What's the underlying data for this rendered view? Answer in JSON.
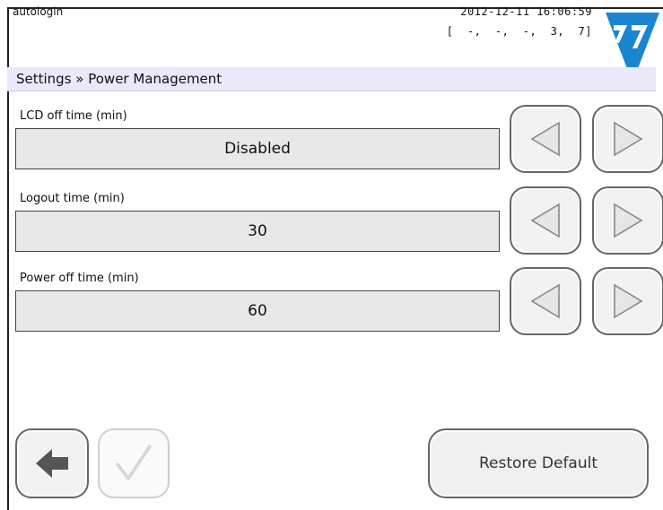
{
  "header": {
    "user": "autologin",
    "datetime": "2012-12-11 16:06:59",
    "codes": "[  -,  -,  -,  3,  7]",
    "logo_icon": "company-logo-icon"
  },
  "breadcrumb": "Settings » Power Management",
  "settings": [
    {
      "label": "LCD off time (min)",
      "value": "Disabled"
    },
    {
      "label": "Logout time (min)",
      "value": "30"
    },
    {
      "label": "Power off time (min)",
      "value": "60"
    }
  ],
  "footer": {
    "back_icon": "back-arrow-icon",
    "ok_icon": "checkmark-icon",
    "ok_enabled": false,
    "restore_label": "Restore Default"
  },
  "colors": {
    "logo_blue": "#1a86d0",
    "breadcrumb_bg": "#e9e9fb"
  }
}
